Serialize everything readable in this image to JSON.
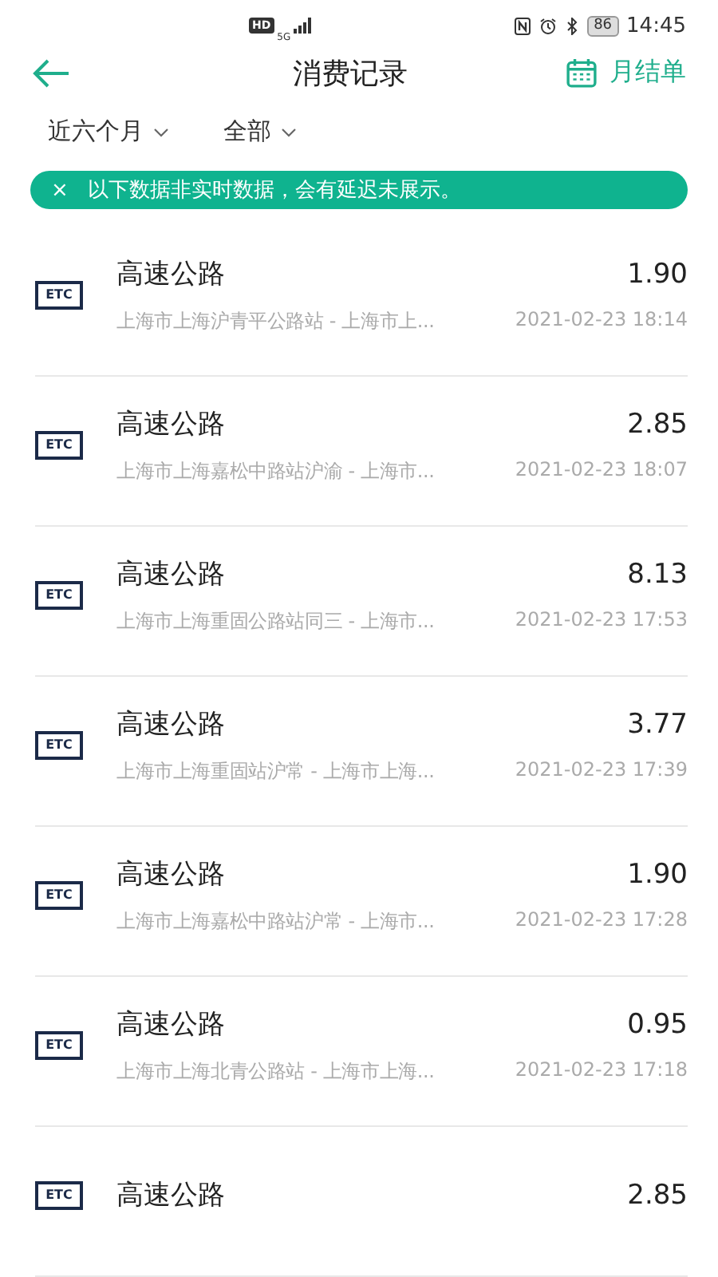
{
  "status_bar": {
    "hd": "HD",
    "network": "5G",
    "battery": "86",
    "time": "14:45"
  },
  "header": {
    "title": "消费记录",
    "action": "月结单"
  },
  "filters": [
    {
      "label": "近六个月"
    },
    {
      "label": "全部"
    }
  ],
  "notice": {
    "close": "×",
    "text": "以下数据非实时数据，会有延迟未展示。"
  },
  "records": [
    {
      "badge": "ETC",
      "title": "高速公路",
      "amount": "1.90",
      "route": "上海市上海沪青平公路站 - 上海市上...",
      "time": "2021-02-23 18:14"
    },
    {
      "badge": "ETC",
      "title": "高速公路",
      "amount": "2.85",
      "route": "上海市上海嘉松中路站沪渝 - 上海市...",
      "time": "2021-02-23 18:07"
    },
    {
      "badge": "ETC",
      "title": "高速公路",
      "amount": "8.13",
      "route": "上海市上海重固公路站同三 - 上海市...",
      "time": "2021-02-23 17:53"
    },
    {
      "badge": "ETC",
      "title": "高速公路",
      "amount": "3.77",
      "route": "上海市上海重固站沪常 - 上海市上海...",
      "time": "2021-02-23 17:39"
    },
    {
      "badge": "ETC",
      "title": "高速公路",
      "amount": "1.90",
      "route": "上海市上海嘉松中路站沪常 - 上海市...",
      "time": "2021-02-23 17:28"
    },
    {
      "badge": "ETC",
      "title": "高速公路",
      "amount": "0.95",
      "route": "上海市上海北青公路站 - 上海市上海...",
      "time": "2021-02-23 17:18"
    },
    {
      "badge": "ETC",
      "title": "高速公路",
      "amount": "2.85"
    }
  ]
}
